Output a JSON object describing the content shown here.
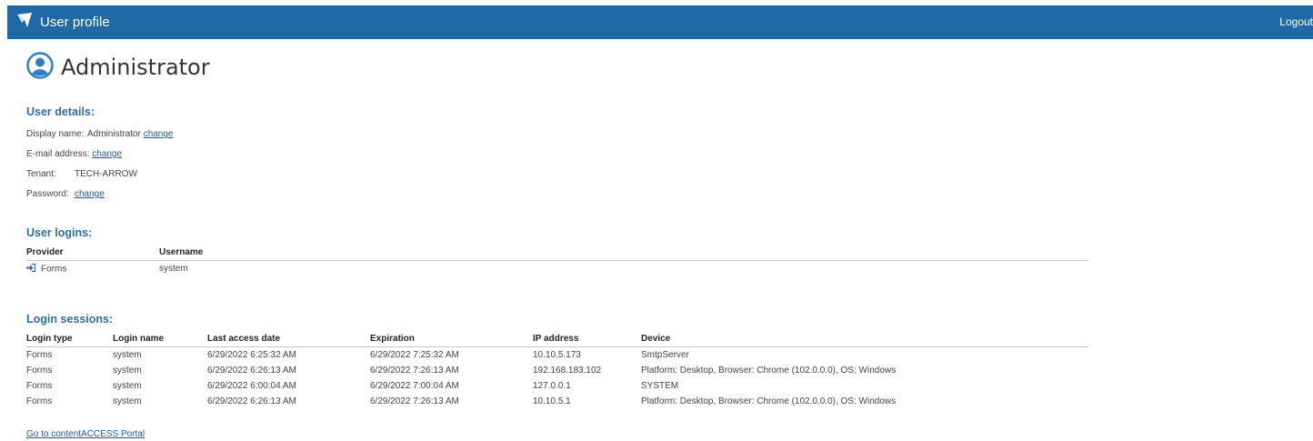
{
  "app": {
    "title": "User profile",
    "logout_label": "Logout",
    "accent_color": "#1f6aa5"
  },
  "profile": {
    "name": "Administrator"
  },
  "user_details": {
    "title": "User details:",
    "display_name_label": "Display name:",
    "display_name_value": "Administrator",
    "display_name_change": "change",
    "email_label": "E-mail address:",
    "email_change": "change",
    "tenant_label": "Tenant:",
    "tenant_value": "TECH-ARROW",
    "password_label": "Password:",
    "password_change": "change"
  },
  "user_logins": {
    "title": "User logins:",
    "columns": [
      "Provider",
      "Username"
    ],
    "rows": [
      {
        "provider": "Forms",
        "username": "system"
      }
    ]
  },
  "login_sessions": {
    "title": "Login sessions:",
    "columns": [
      "Login type",
      "Login name",
      "Last access date",
      "Expiration",
      "IP address",
      "Device"
    ],
    "rows": [
      [
        "Forms",
        "system",
        "6/29/2022 6:25:32 AM",
        "6/29/2022 7:25:32 AM",
        "10.10.5.173",
        "SmtpServer"
      ],
      [
        "Forms",
        "system",
        "6/29/2022 6:26:13 AM",
        "6/29/2022 7:26:13 AM",
        "192.168.183.102",
        "Platform: Desktop, Browser: Chrome (102.0.0.0), OS: Windows"
      ],
      [
        "Forms",
        "system",
        "6/29/2022 6:00:04 AM",
        "6/29/2022 7:00:04 AM",
        "127.0.0.1",
        "SYSTEM"
      ],
      [
        "Forms",
        "system",
        "6/29/2022 6:26:13 AM",
        "6/29/2022 7:26:13 AM",
        "10.10.5.1",
        "Platform: Desktop, Browser: Chrome (102.0.0.0), OS: Windows"
      ]
    ]
  },
  "footer": {
    "portal_link": "Go to contentACCESS Portal"
  }
}
